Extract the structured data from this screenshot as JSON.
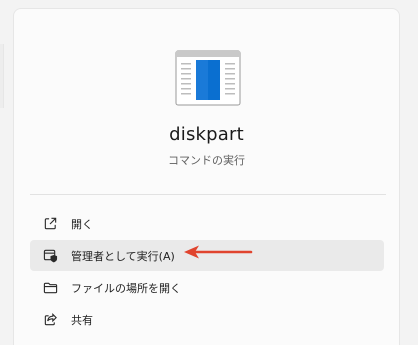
{
  "app": {
    "name": "diskpart",
    "type": "コマンドの実行",
    "icon": "console-window-icon"
  },
  "actions": [
    {
      "label": "開く",
      "icon": "open-external-icon",
      "selected": false
    },
    {
      "label": "管理者として実行(A)",
      "icon": "shield-run-icon",
      "selected": true
    },
    {
      "label": "ファイルの場所を開く",
      "icon": "folder-icon",
      "selected": false
    },
    {
      "label": "共有",
      "icon": "share-icon",
      "selected": false
    }
  ],
  "annotation": {
    "type": "arrow",
    "color": "#e0442e"
  },
  "colors": {
    "panel_bg": "#fbfbfb",
    "selected_bg": "#eaeaea",
    "icon_blue": "#0a6fd0"
  }
}
